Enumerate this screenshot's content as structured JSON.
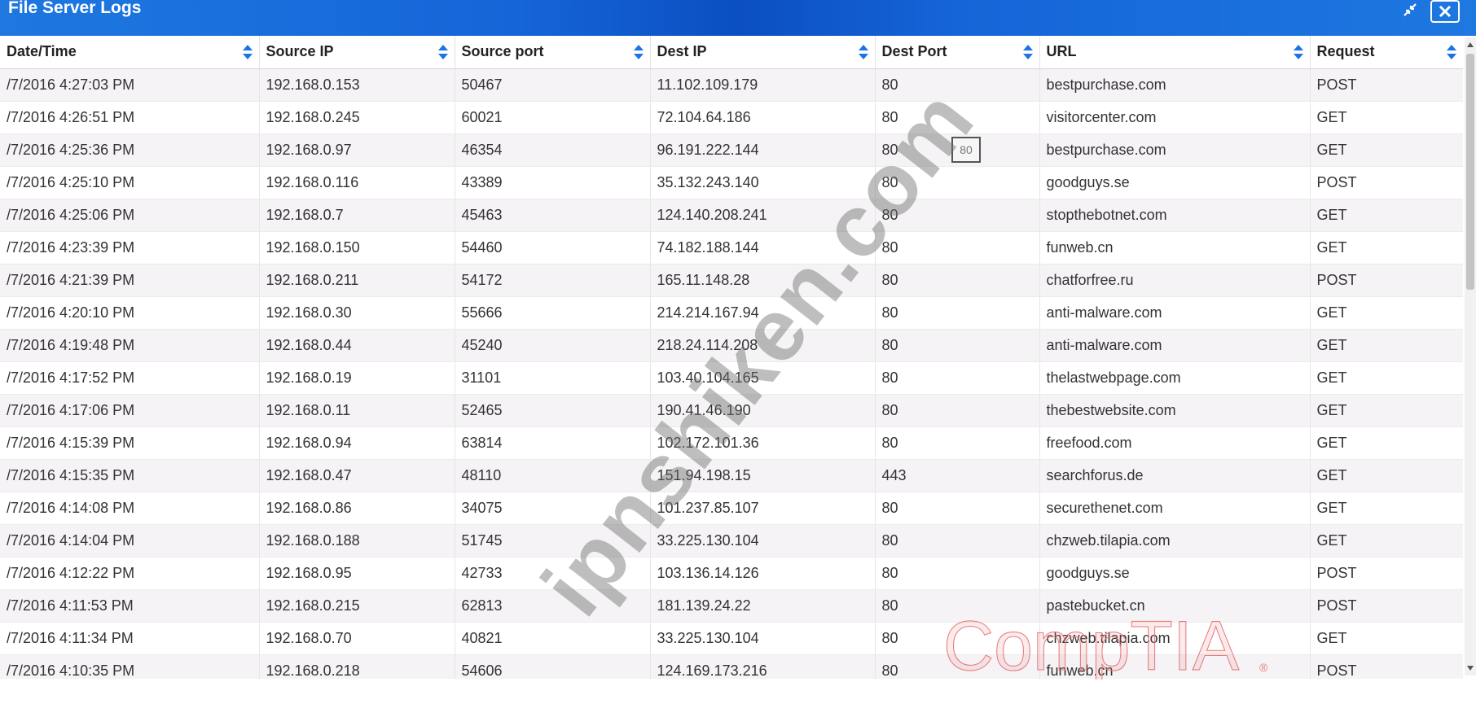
{
  "window": {
    "title": "File Server Logs",
    "restore_icon": "restore-icon",
    "close_icon": "close-icon"
  },
  "columns": [
    "Date/Time",
    "Source IP",
    "Source port",
    "Dest IP",
    "Dest Port",
    "URL",
    "Request"
  ],
  "rows": [
    [
      "/7/2016 4:27:03 PM",
      "192.168.0.153",
      "50467",
      "11.102.109.179",
      "80",
      "bestpurchase.com",
      "POST"
    ],
    [
      "/7/2016 4:26:51 PM",
      "192.168.0.245",
      "60021",
      "72.104.64.186",
      "80",
      "visitorcenter.com",
      "GET"
    ],
    [
      "/7/2016 4:25:36 PM",
      "192.168.0.97",
      "46354",
      "96.191.222.144",
      "80",
      "bestpurchase.com",
      "GET"
    ],
    [
      "/7/2016 4:25:10 PM",
      "192.168.0.116",
      "43389",
      "35.132.243.140",
      "80",
      "goodguys.se",
      "POST"
    ],
    [
      "/7/2016 4:25:06 PM",
      "192.168.0.7",
      "45463",
      "124.140.208.241",
      "80",
      "stopthebotnet.com",
      "GET"
    ],
    [
      "/7/2016 4:23:39 PM",
      "192.168.0.150",
      "54460",
      "74.182.188.144",
      "80",
      "funweb.cn",
      "GET"
    ],
    [
      "/7/2016 4:21:39 PM",
      "192.168.0.211",
      "54172",
      "165.11.148.28",
      "80",
      "chatforfree.ru",
      "POST"
    ],
    [
      "/7/2016 4:20:10 PM",
      "192.168.0.30",
      "55666",
      "214.214.167.94",
      "80",
      "anti-malware.com",
      "GET"
    ],
    [
      "/7/2016 4:19:48 PM",
      "192.168.0.44",
      "45240",
      "218.24.114.208",
      "80",
      "anti-malware.com",
      "GET"
    ],
    [
      "/7/2016 4:17:52 PM",
      "192.168.0.19",
      "31101",
      "103.40.104.165",
      "80",
      "thelastwebpage.com",
      "GET"
    ],
    [
      "/7/2016 4:17:06 PM",
      "192.168.0.11",
      "52465",
      "190.41.46.190",
      "80",
      "thebestwebsite.com",
      "GET"
    ],
    [
      "/7/2016 4:15:39 PM",
      "192.168.0.94",
      "63814",
      "102.172.101.36",
      "80",
      "freefood.com",
      "GET"
    ],
    [
      "/7/2016 4:15:35 PM",
      "192.168.0.47",
      "48110",
      "151.94.198.15",
      "443",
      "searchforus.de",
      "GET"
    ],
    [
      "/7/2016 4:14:08 PM",
      "192.168.0.86",
      "34075",
      "101.237.85.107",
      "80",
      "securethenet.com",
      "GET"
    ],
    [
      "/7/2016 4:14:04 PM",
      "192.168.0.188",
      "51745",
      "33.225.130.104",
      "80",
      "chzweb.tilapia.com",
      "GET"
    ],
    [
      "/7/2016 4:12:22 PM",
      "192.168.0.95",
      "42733",
      "103.136.14.126",
      "80",
      "goodguys.se",
      "POST"
    ],
    [
      "/7/2016 4:11:53 PM",
      "192.168.0.215",
      "62813",
      "181.139.24.22",
      "80",
      "pastebucket.cn",
      "POST"
    ],
    [
      "/7/2016 4:11:34 PM",
      "192.168.0.70",
      "40821",
      "33.225.130.104",
      "80",
      "chzweb.tilapia.com",
      "GET"
    ],
    [
      "/7/2016 4:10:35 PM",
      "192.168.0.218",
      "54606",
      "124.169.173.216",
      "80",
      "funweb.cn",
      "POST"
    ]
  ],
  "tooltip": {
    "text": "80"
  },
  "watermark": {
    "text": "ipnshiken.com"
  },
  "logo": {
    "text": "CompTIA",
    "mark": "®"
  },
  "colors": {
    "titlebar": "#1e78e0",
    "titlebar_dark": "#0b4fc2",
    "sort_icon": "#1a73e8",
    "logo": "#e8767a"
  },
  "icons": {
    "sort": "sort-arrows-icon",
    "scroll_up": "arrow-up-icon",
    "scroll_down": "arrow-down-icon"
  }
}
